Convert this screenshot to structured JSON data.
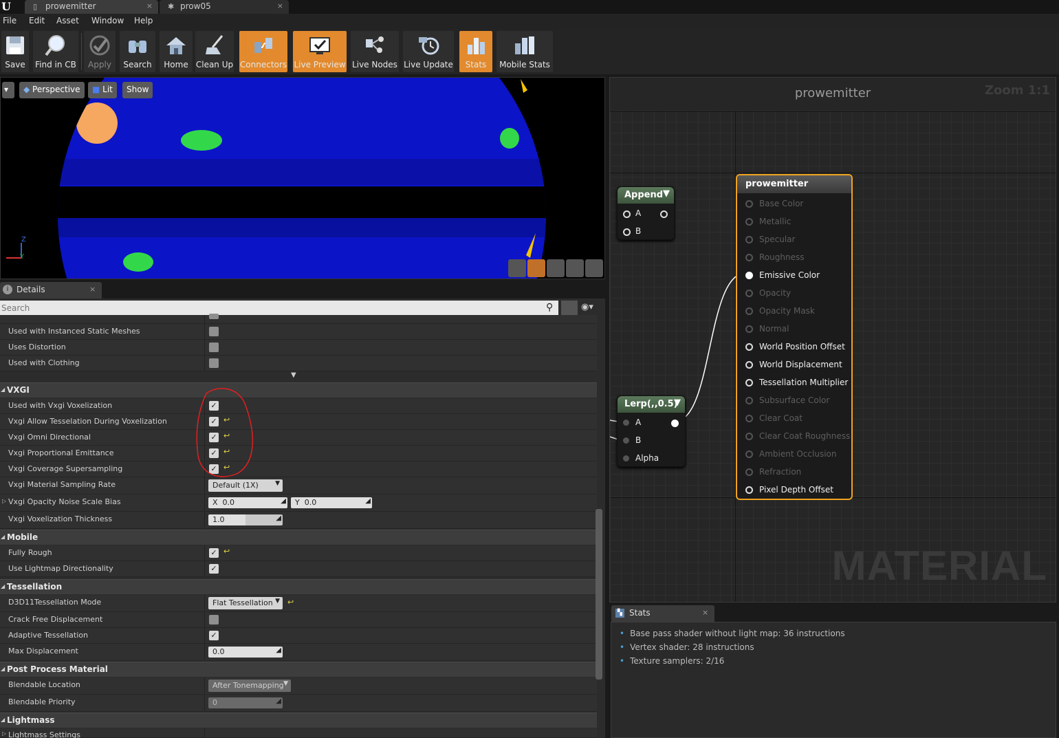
{
  "tabs": [
    {
      "label": "prowemitter"
    },
    {
      "label": "prow05"
    }
  ],
  "menu": [
    "File",
    "Edit",
    "Asset",
    "Window",
    "Help"
  ],
  "toolbar": [
    {
      "label": "Save"
    },
    {
      "label": "Find in CB"
    },
    {
      "label": "Apply"
    },
    {
      "label": "Search"
    },
    {
      "label": "Home"
    },
    {
      "label": "Clean Up"
    },
    {
      "label": "Connectors"
    },
    {
      "label": "Live Preview"
    },
    {
      "label": "Live Nodes"
    },
    {
      "label": "Live Update"
    },
    {
      "label": "Stats"
    },
    {
      "label": "Mobile Stats"
    }
  ],
  "viewport": {
    "perspective": "Perspective",
    "lit": "Lit",
    "show": "Show",
    "axis_z": "Z",
    "axis_y": "Y"
  },
  "details": {
    "tab": "Details",
    "search_placeholder": "Search",
    "rows_top": [
      {
        "label": "Used with Instanced Static Meshes",
        "checked": false
      },
      {
        "label": "Uses Distortion",
        "checked": false
      },
      {
        "label": "Used with Clothing",
        "checked": false
      }
    ],
    "vxgi": {
      "title": "VXGI",
      "rows": [
        {
          "label": "Used with Vxgi Voxelization"
        },
        {
          "label": "Vxgi Allow Tesselation During Voxelization"
        },
        {
          "label": "Vxgi Omni Directional"
        },
        {
          "label": "Vxgi Proportional Emittance"
        },
        {
          "label": "Vxgi Coverage Supersampling"
        }
      ],
      "sampling_label": "Vxgi Material Sampling Rate",
      "sampling_value": "Default (1X)",
      "noise_label": "Vxgi Opacity Noise Scale Bias",
      "noise_x_lbl": "X",
      "noise_x": "0.0",
      "noise_y_lbl": "Y",
      "noise_y": "0.0",
      "thickness_label": "Vxgi Voxelization Thickness",
      "thickness_value": "1.0"
    },
    "mobile": {
      "title": "Mobile",
      "rows": [
        {
          "label": "Fully Rough"
        },
        {
          "label": "Use Lightmap Directionality"
        }
      ]
    },
    "tessellation": {
      "title": "Tessellation",
      "mode_label": "D3D11Tessellation Mode",
      "mode_value": "Flat Tessellation",
      "crack_label": "Crack Free Displacement",
      "adaptive_label": "Adaptive Tessellation",
      "maxdisp_label": "Max Displacement",
      "maxdisp_value": "0.0"
    },
    "postprocess": {
      "title": "Post Process Material",
      "loc_label": "Blendable Location",
      "loc_value": "After Tonemapping",
      "prio_label": "Blendable Priority",
      "prio_value": "0"
    },
    "lightmass": {
      "title": "Lightmass",
      "settings_label": "Lightmass Settings"
    }
  },
  "graph": {
    "title": "prowemitter",
    "zoom": "Zoom 1:1",
    "watermark": "MATERIAL",
    "append": {
      "title": "Append",
      "a": "A",
      "b": "B"
    },
    "lerp": {
      "title": "Lerp(,,0.5)",
      "a": "A",
      "b": "B",
      "alpha": "Alpha"
    },
    "material": {
      "title": "prowemitter",
      "inputs": [
        {
          "label": "Base Color",
          "state": "off"
        },
        {
          "label": "Metallic",
          "state": "off"
        },
        {
          "label": "Specular",
          "state": "off"
        },
        {
          "label": "Roughness",
          "state": "off"
        },
        {
          "label": "Emissive Color",
          "state": "filled"
        },
        {
          "label": "Opacity",
          "state": "off"
        },
        {
          "label": "Opacity Mask",
          "state": "off"
        },
        {
          "label": "Normal",
          "state": "off"
        },
        {
          "label": "World Position Offset",
          "state": "on"
        },
        {
          "label": "World Displacement",
          "state": "on"
        },
        {
          "label": "Tessellation Multiplier",
          "state": "on"
        },
        {
          "label": "Subsurface Color",
          "state": "off"
        },
        {
          "label": "Clear Coat",
          "state": "off"
        },
        {
          "label": "Clear Coat Roughness",
          "state": "off"
        },
        {
          "label": "Ambient Occlusion",
          "state": "off"
        },
        {
          "label": "Refraction",
          "state": "off"
        },
        {
          "label": "Pixel Depth Offset",
          "state": "on"
        }
      ]
    }
  },
  "stats": {
    "tab": "Stats",
    "lines": [
      "Base pass shader without light map: 36 instructions",
      "Vertex shader: 28 instructions",
      "Texture samplers: 2/16"
    ]
  }
}
